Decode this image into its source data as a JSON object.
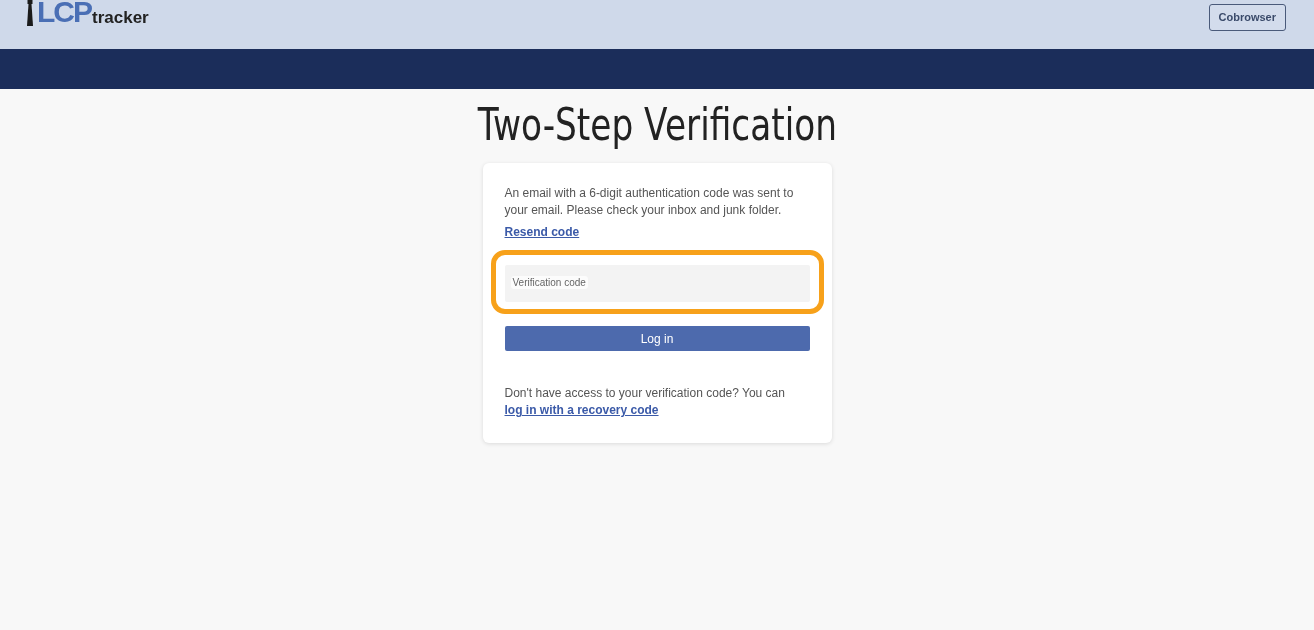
{
  "header": {
    "logo": {
      "mark": "LCP",
      "word": "tracker"
    },
    "button": "Cobrowser"
  },
  "title": "Two-Step Verification",
  "card": {
    "message": "An email with a 6-digit authentication code was sent to your email. Please check your inbox and junk folder.",
    "resend_link": "Resend code",
    "field": {
      "label": "Verification code",
      "highlighted": true
    },
    "submit": "Log in",
    "footer": {
      "text": "Don't have access to your verification code? You can",
      "link": "log in with a recovery code"
    }
  }
}
